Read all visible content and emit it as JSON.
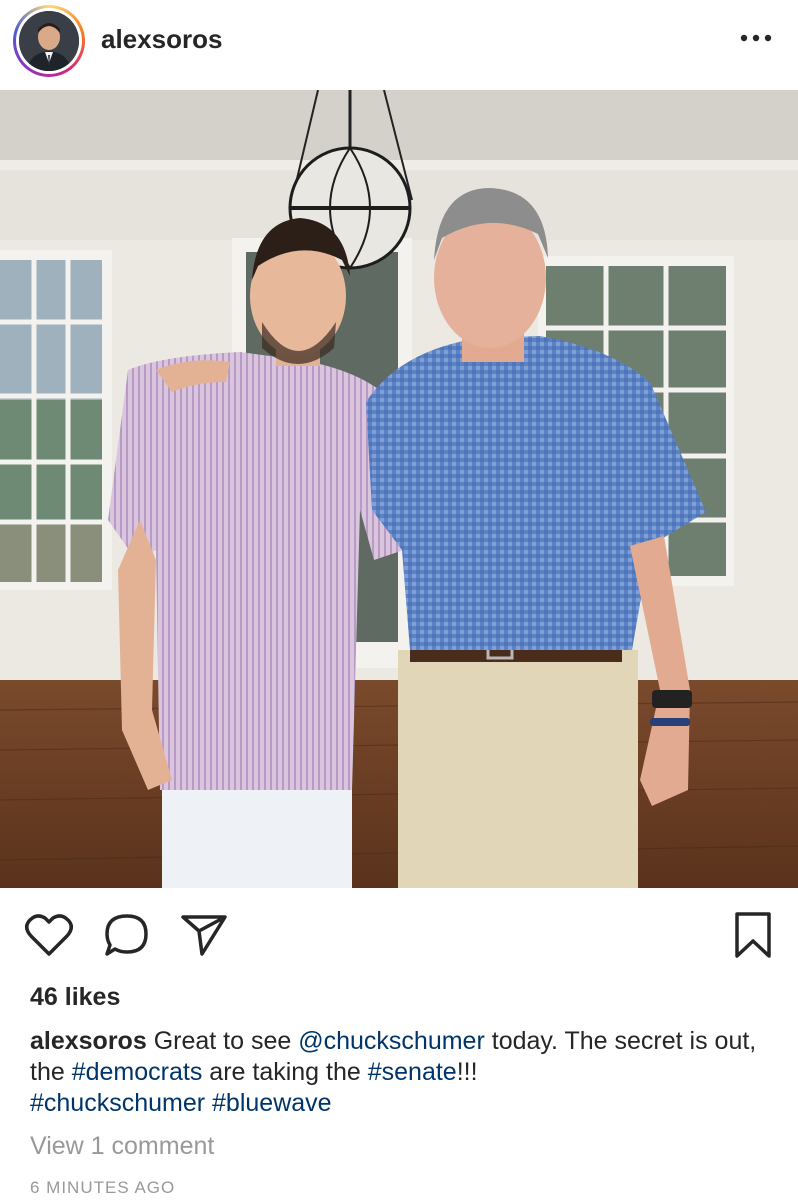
{
  "post": {
    "username": "alexsoros",
    "likes": "46 likes",
    "caption": {
      "username": "alexsoros",
      "text_1": "Great to see",
      "mention": "@chuckschumer",
      "text_2": "today. The secret is out, the",
      "hashtag_1": "#democrats",
      "text_3": "are taking the",
      "hashtag_2": "#senate",
      "text_4": "!!!",
      "hashtag_3": "#chuckschumer",
      "hashtag_4": "#bluewave"
    },
    "view_comments": "View 1 comment",
    "timestamp": "6 MINUTES AGO"
  },
  "icons": {
    "more": "more-horizontal-icon",
    "like": "heart-icon",
    "comment": "comment-bubble-icon",
    "share": "paper-plane-icon",
    "save": "bookmark-icon"
  },
  "colors": {
    "text": "#262626",
    "link": "#003569",
    "secondary": "#999999"
  }
}
